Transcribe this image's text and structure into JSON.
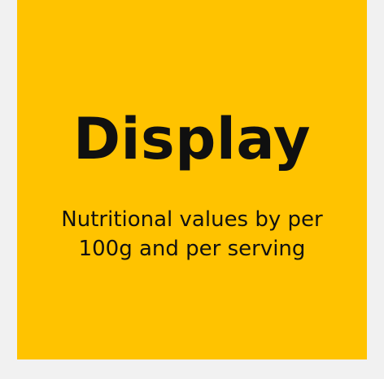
{
  "card": {
    "title": "Display",
    "subtitle_line1": "Nutritional values by per",
    "subtitle_line2": "100g and per serving"
  },
  "colors": {
    "page_background": "#f1f1f1",
    "card_background": "#ffc300",
    "text": "#101010"
  }
}
